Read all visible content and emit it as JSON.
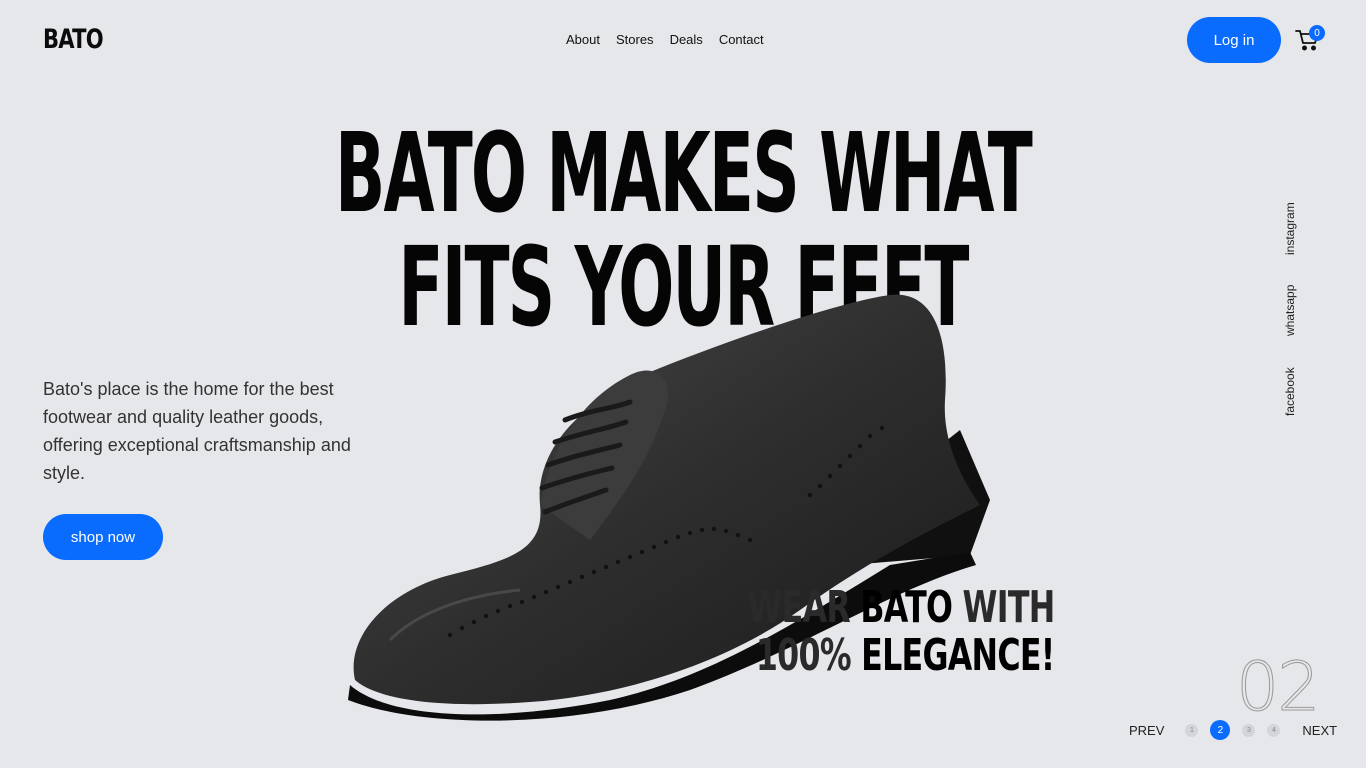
{
  "brand": {
    "logo": "BATO"
  },
  "nav": {
    "items": [
      "About",
      "Stores",
      "Deals",
      "Contact"
    ]
  },
  "header": {
    "login_label": "Log in",
    "cart_count": "0"
  },
  "hero": {
    "headline_line1": "BATO MAKES WHAT",
    "headline_line2": "FITS YOUR FEET",
    "description": "Bato's place is the home for the best footwear and quality leather goods, offering exceptional craftsmanship and style.",
    "cta_label": "shop now",
    "tagline": {
      "w1": "WEAR",
      "w2": "BATO",
      "w3": "WITH",
      "w4": "100%",
      "w5": "ELEGANCE!"
    }
  },
  "social": {
    "links": [
      "instagram",
      "whatsapp",
      "facebook"
    ]
  },
  "slider": {
    "current_number": "02",
    "prev_label": "PREV",
    "next_label": "NEXT",
    "pages": [
      "1",
      "2",
      "3",
      "4"
    ],
    "active_index": 1
  },
  "colors": {
    "accent": "#0a6cff",
    "background": "#e6e7eb",
    "text": "#111111"
  }
}
